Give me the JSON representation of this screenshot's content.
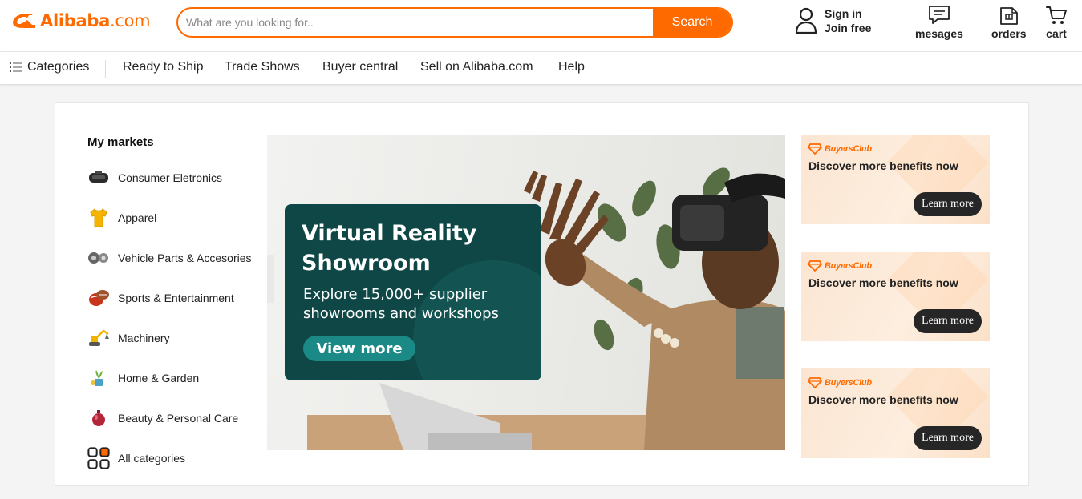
{
  "header": {
    "logo_text": "Alibaba",
    "logo_suffix": ".com",
    "search_placeholder": "What are you looking for..",
    "search_button": "Search",
    "signin_line1": "Sign in",
    "signin_line2": "Join free",
    "messages_label": "mesages",
    "orders_label": "orders",
    "cart_label": "cart"
  },
  "nav": {
    "categories": "Categories",
    "items": [
      "Ready to Ship",
      "Trade Shows",
      "Buyer central",
      "Sell on Alibaba.com",
      "Help"
    ]
  },
  "markets": {
    "title": "My markets",
    "items": [
      {
        "label": "Consumer Eletronics",
        "icon": "vr-headset-icon"
      },
      {
        "label": "Apparel",
        "icon": "shirt-icon"
      },
      {
        "label": "Vehicle Parts & Accesories",
        "icon": "car-parts-icon"
      },
      {
        "label": "Sports & Entertainment",
        "icon": "sports-balls-icon"
      },
      {
        "label": "Machinery",
        "icon": "excavator-icon"
      },
      {
        "label": "Home & Garden",
        "icon": "garden-icon"
      },
      {
        "label": "Beauty & Personal Care",
        "icon": "perfume-icon"
      },
      {
        "label": "All categories",
        "icon": "grid-icon"
      }
    ]
  },
  "hero": {
    "title": "Virtual Reality Showroom",
    "subtitle": "Explore 15,000+ supplier showrooms and workshops",
    "button": "View more"
  },
  "promos": [
    {
      "brand": "BuyersClub",
      "text": "Discover more benefits now",
      "button": "Learn more"
    },
    {
      "brand": "BuyersClub",
      "text": "Discover more benefits now",
      "button": "Learn more"
    },
    {
      "brand": "BuyersClub",
      "text": "Discover more benefits now",
      "button": "Learn more"
    }
  ],
  "colors": {
    "brand_orange": "#ff6a00",
    "panel_teal": "#0f4746",
    "button_teal": "#1b8a86",
    "dark_button": "#262626"
  }
}
